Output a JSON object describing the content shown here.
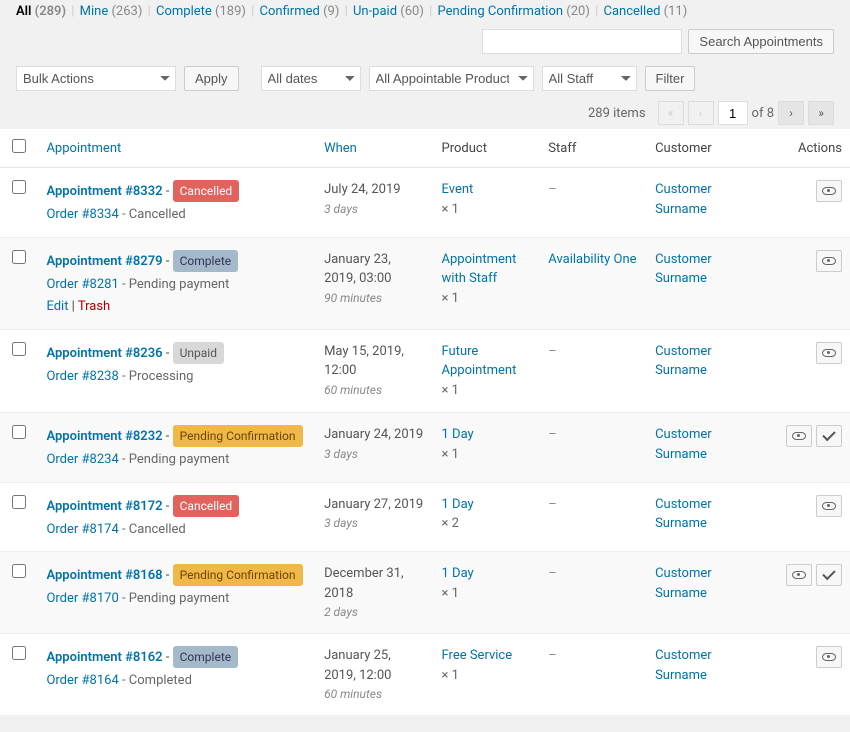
{
  "tabs": [
    {
      "label": "All",
      "count": "(289)",
      "current": true
    },
    {
      "label": "Mine",
      "count": "(263)"
    },
    {
      "label": "Complete",
      "count": "(189)"
    },
    {
      "label": "Confirmed",
      "count": "(9)"
    },
    {
      "label": "Un-paid",
      "count": "(60)"
    },
    {
      "label": "Pending Confirmation",
      "count": "(20)"
    },
    {
      "label": "Cancelled",
      "count": "(11)"
    }
  ],
  "search": {
    "placeholder": "",
    "button": "Search Appointments"
  },
  "controls": {
    "bulk": "Bulk Actions",
    "apply": "Apply",
    "dates": "All dates",
    "products": "All Appointable Products",
    "staff": "All Staff",
    "filter": "Filter"
  },
  "pagination": {
    "items": "289 items",
    "page": "1",
    "of": "of 8"
  },
  "columns": {
    "appt": "Appointment",
    "when": "When",
    "product": "Product",
    "staff": "Staff",
    "customer": "Customer",
    "actions": "Actions"
  },
  "rows": [
    {
      "title": "Appointment #8332",
      "status": "Cancelled",
      "statusClass": "cancelled",
      "order": "Order #8334",
      "orderStatus": "Cancelled",
      "when": "July 24, 2019",
      "dur": "3 days",
      "product": "Event",
      "qty": "× 1",
      "staff": "–",
      "custFirst": "Customer",
      "custLast": "Surname",
      "confirm": false,
      "rowActs": false
    },
    {
      "title": "Appointment #8279",
      "status": "Complete",
      "statusClass": "complete",
      "order": "Order #8281",
      "orderStatus": "Pending payment",
      "when": "January 23, 2019, 03:00",
      "dur": "90 minutes",
      "product": "Appointment with Staff",
      "qty": "× 1",
      "staff": "Availability One",
      "custFirst": "Customer",
      "custLast": "Surname",
      "confirm": false,
      "rowActs": true
    },
    {
      "title": "Appointment #8236",
      "status": "Unpaid",
      "statusClass": "unpaid",
      "order": "Order #8238",
      "orderStatus": "Processing",
      "when": "May 15, 2019, 12:00",
      "dur": "60 minutes",
      "product": "Future Appointment",
      "qty": "× 1",
      "staff": "–",
      "custFirst": "Customer",
      "custLast": "Surname",
      "confirm": false,
      "rowActs": false
    },
    {
      "title": "Appointment #8232",
      "status": "Pending Confirmation",
      "statusClass": "pending-confirmation",
      "order": "Order #8234",
      "orderStatus": "Pending payment",
      "when": "January 24, 2019",
      "dur": "3 days",
      "product": "1 Day",
      "qty": "× 1",
      "staff": "–",
      "custFirst": "Customer",
      "custLast": "Surname",
      "confirm": true,
      "rowActs": false
    },
    {
      "title": "Appointment #8172",
      "status": "Cancelled",
      "statusClass": "cancelled",
      "order": "Order #8174",
      "orderStatus": "Cancelled",
      "when": "January 27, 2019",
      "dur": "3 days",
      "product": "1 Day",
      "qty": "× 2",
      "staff": "–",
      "custFirst": "Customer",
      "custLast": "Surname",
      "confirm": false,
      "rowActs": false
    },
    {
      "title": "Appointment #8168",
      "status": "Pending Confirmation",
      "statusClass": "pending-confirmation",
      "order": "Order #8170",
      "orderStatus": "Pending payment",
      "when": "December 31, 2018",
      "dur": "2 days",
      "product": "1 Day",
      "qty": "× 1",
      "staff": "–",
      "custFirst": "Customer",
      "custLast": "Surname",
      "confirm": true,
      "rowActs": false
    },
    {
      "title": "Appointment #8162",
      "status": "Complete",
      "statusClass": "complete",
      "order": "Order #8164",
      "orderStatus": "Completed",
      "when": "January 25, 2019, 12:00",
      "dur": "60 minutes",
      "product": "Free Service",
      "qty": "× 1",
      "staff": "–",
      "custFirst": "Customer",
      "custLast": "Surname",
      "confirm": false,
      "rowActs": false
    }
  ],
  "rowActions": {
    "edit": "Edit",
    "trash": "Trash",
    "sep": " | "
  }
}
